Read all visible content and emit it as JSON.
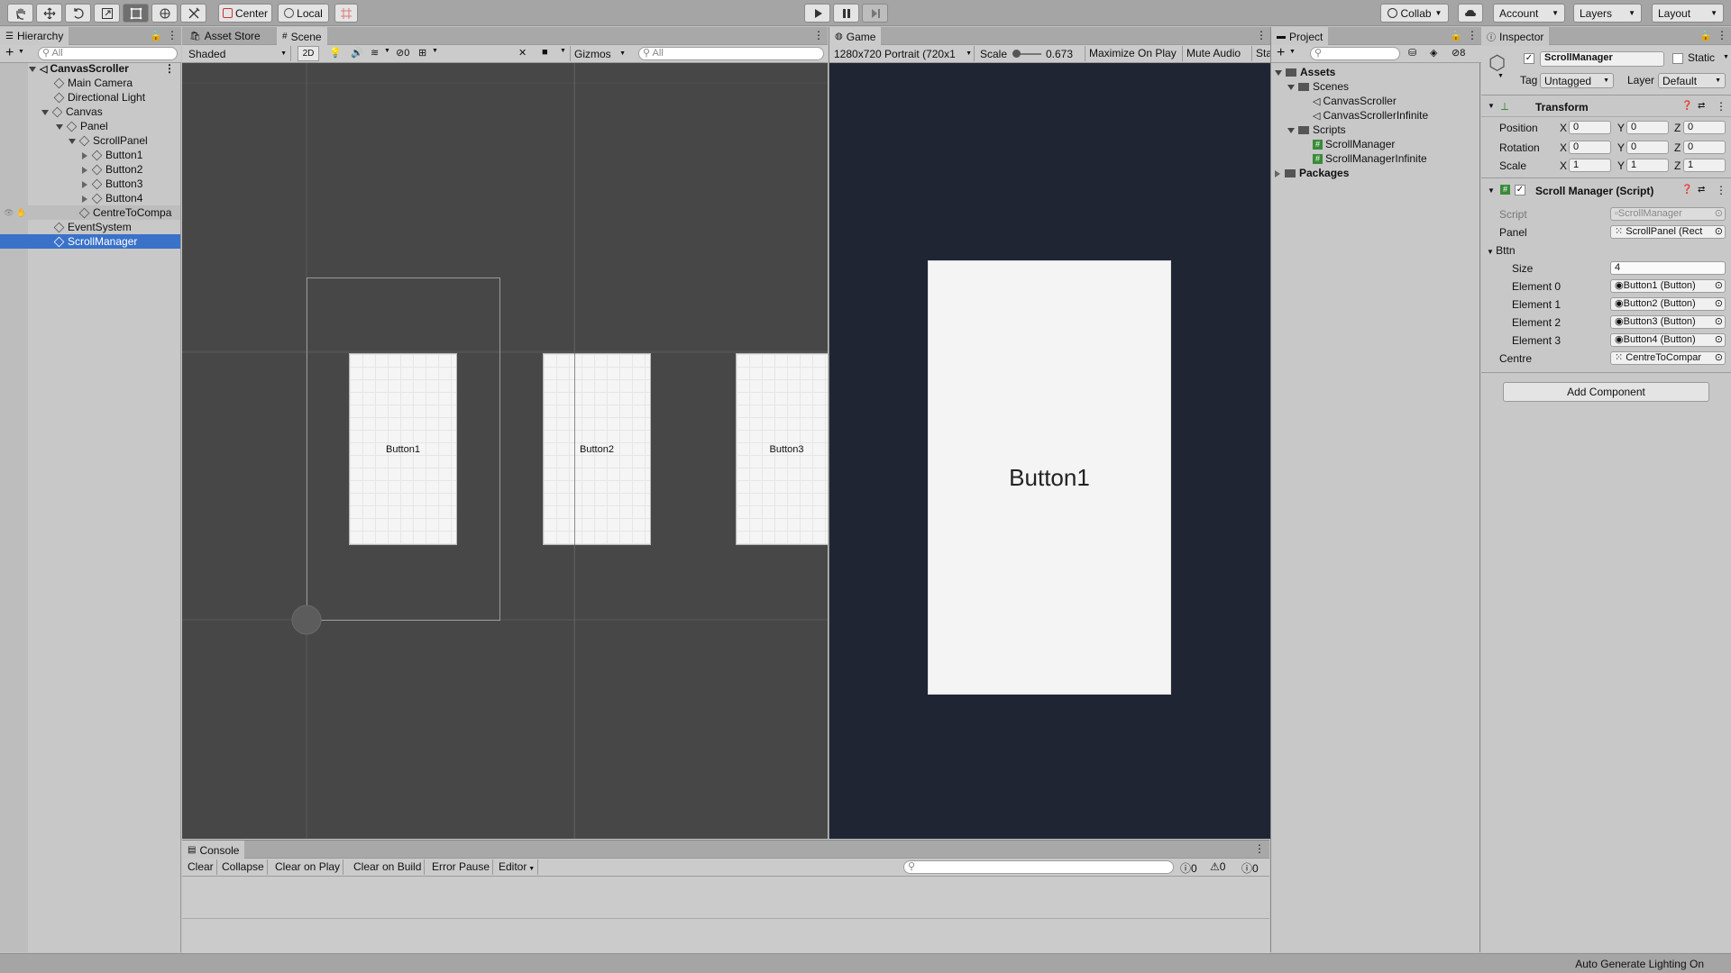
{
  "toolbar": {
    "center_label": "Center",
    "local_label": "Local",
    "collab_label": "Collab",
    "account_label": "Account",
    "layers_label": "Layers",
    "layout_label": "Layout"
  },
  "hierarchy": {
    "tab": "Hierarchy",
    "search_placeholder": "All",
    "items": [
      {
        "label": "CanvasScroller",
        "bold": true
      },
      {
        "label": "Main Camera"
      },
      {
        "label": "Directional Light"
      },
      {
        "label": "Canvas"
      },
      {
        "label": "Panel"
      },
      {
        "label": "ScrollPanel"
      },
      {
        "label": "Button1"
      },
      {
        "label": "Button2"
      },
      {
        "label": "Button3"
      },
      {
        "label": "Button4"
      },
      {
        "label": "CentreToCompa"
      },
      {
        "label": "EventSystem"
      },
      {
        "label": "ScrollManager",
        "selected": true
      }
    ]
  },
  "scene": {
    "tab_asset_store": "Asset Store",
    "tab_scene": "Scene",
    "shading": "Shaded",
    "mode_2d": "2D",
    "hidden_count": "0",
    "gizmos": "Gizmos",
    "search_placeholder": "All",
    "buttons": [
      "Button1",
      "Button2",
      "Button3"
    ]
  },
  "game": {
    "tab": "Game",
    "resolution": "1280x720 Portrait (720x1",
    "scale_label": "Scale",
    "scale_value": "0.673",
    "maximize": "Maximize On Play",
    "mute": "Mute Audio",
    "stats": "Sta",
    "button_label": "Button1"
  },
  "project": {
    "tab": "Project",
    "hidden_count": "8",
    "items": [
      {
        "label": "Assets",
        "bold": true
      },
      {
        "label": "Scenes"
      },
      {
        "label": "CanvasScroller"
      },
      {
        "label": "CanvasScrollerInfinite"
      },
      {
        "label": "Scripts"
      },
      {
        "label": "ScrollManager"
      },
      {
        "label": "ScrollManagerInfinite"
      },
      {
        "label": "Packages",
        "bold": true
      }
    ]
  },
  "inspector": {
    "tab": "Inspector",
    "object_name": "ScrollManager",
    "static_label": "Static",
    "tag_label": "Tag",
    "tag_value": "Untagged",
    "layer_label": "Layer",
    "layer_value": "Default",
    "transform_title": "Transform",
    "position_label": "Position",
    "rotation_label": "Rotation",
    "scale_label": "Scale",
    "position": [
      "0",
      "0",
      "0"
    ],
    "rotation": [
      "0",
      "0",
      "0"
    ],
    "scale": [
      "1",
      "1",
      "1"
    ],
    "axis_labels": [
      "X",
      "Y",
      "Z"
    ],
    "script_component_title": "Scroll Manager (Script)",
    "script_label": "Script",
    "script_value": "ScrollManager",
    "panel_label": "Panel",
    "panel_value": "ScrollPanel (Rect",
    "bttn_label": "Bttn",
    "size_label": "Size",
    "size_value": "4",
    "elements": [
      {
        "label": "Element 0",
        "value": "Button1 (Button)"
      },
      {
        "label": "Element 1",
        "value": "Button2 (Button)"
      },
      {
        "label": "Element 2",
        "value": "Button3 (Button)"
      },
      {
        "label": "Element 3",
        "value": "Button4 (Button)"
      }
    ],
    "centre_label": "Centre",
    "centre_value": "CentreToCompar",
    "add_component": "Add Component"
  },
  "console": {
    "tab": "Console",
    "clear": "Clear",
    "collapse": "Collapse",
    "clear_on_play": "Clear on Play",
    "clear_on_build": "Clear on Build",
    "error_pause": "Error Pause",
    "editor": "Editor",
    "log_count": "0",
    "warn_count": "0",
    "error_count": "0"
  },
  "statusbar": {
    "text": "Auto Generate Lighting On"
  }
}
